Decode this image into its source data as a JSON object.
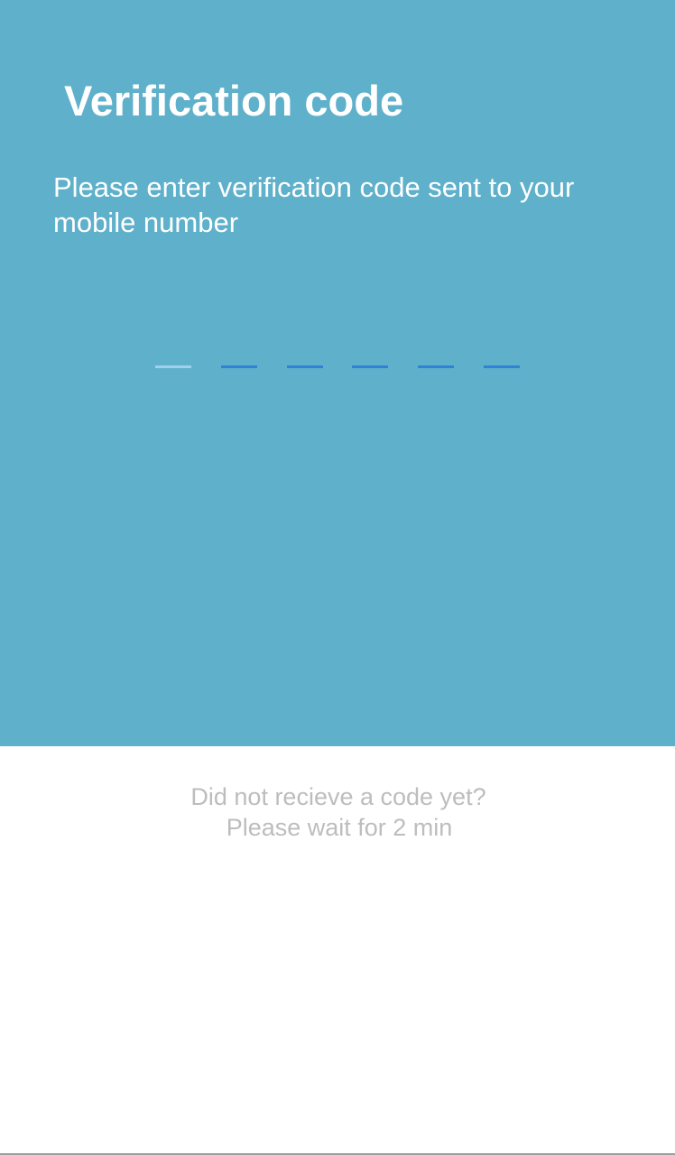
{
  "screen": {
    "title": "Verification code",
    "instructions": "Please enter verification code sent to your mobile number"
  },
  "verification": {
    "digits": [
      "",
      "",
      "",
      "",
      "",
      ""
    ],
    "active_slot": 1
  },
  "resend": {
    "question": "Did not recieve a code yet?",
    "wait_message": "Please wait for 2 min"
  },
  "colors": {
    "header_background": "#5fb0ca",
    "title_text": "#ffffff",
    "inactive_underline": "#2f83d6",
    "active_underline": "#9fd1ef",
    "helper_text": "#bdbdbd"
  }
}
